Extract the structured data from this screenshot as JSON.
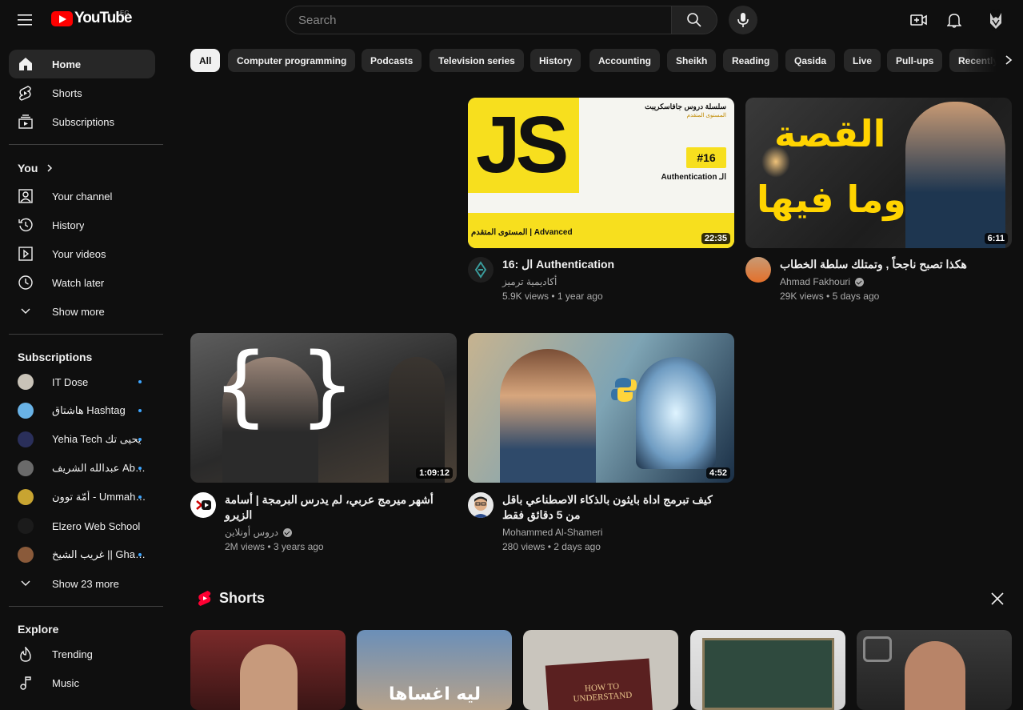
{
  "header": {
    "logo_text": "YouTube",
    "country_code": "EG",
    "search_placeholder": "Search"
  },
  "sidebar": {
    "main": [
      {
        "label": "Home",
        "icon": "home-icon"
      },
      {
        "label": "Shorts",
        "icon": "shorts-icon"
      },
      {
        "label": "Subscriptions",
        "icon": "subscriptions-icon"
      }
    ],
    "you_heading": "You",
    "you": [
      {
        "label": "Your channel",
        "icon": "your-channel-icon"
      },
      {
        "label": "History",
        "icon": "history-icon"
      },
      {
        "label": "Your videos",
        "icon": "your-videos-icon"
      },
      {
        "label": "Watch later",
        "icon": "watch-later-icon"
      },
      {
        "label": "Show more",
        "icon": "chevron-down-icon"
      }
    ],
    "subscriptions_heading": "Subscriptions",
    "subscriptions": [
      {
        "label": "IT Dose",
        "color": "#c9c3b8",
        "new": true
      },
      {
        "label": "هاشتاق Hashtag",
        "color": "#69b3e7",
        "new": true
      },
      {
        "label": "Yehia Tech يحيى تك",
        "color": "#2a2f5a",
        "new": true
      },
      {
        "label": "عبدالله الشريف Abdullah",
        "color": "#6a6a6a",
        "new": true
      },
      {
        "label": "أمّة توون - Ummah Toon",
        "color": "#c8a431",
        "new": true
      },
      {
        "label": "Elzero Web School",
        "color": "#1b1b1b",
        "new": false
      },
      {
        "label": "غريب الشيخ || Gharib",
        "color": "#8a5a3a",
        "new": true
      }
    ],
    "show_more_subs": "Show 23 more",
    "explore_heading": "Explore",
    "explore": [
      {
        "label": "Trending",
        "icon": "trending-icon"
      },
      {
        "label": "Music",
        "icon": "music-icon"
      }
    ]
  },
  "chips": [
    "All",
    "Computer programming",
    "Podcasts",
    "Television series",
    "History",
    "Accounting",
    "Sheikh",
    "Reading",
    "Qasida",
    "Live",
    "Pull-ups",
    "Recently uploaded"
  ],
  "videos": [
    {
      "title": "16: ال Authentication",
      "channel": "أكاديمية ترميز",
      "verified": false,
      "views": "5.9K views",
      "age": "1 year ago",
      "duration": "22:35",
      "thumb_text": {
        "js": "JS",
        "series": "سلسلة دروس جافاسكريبت",
        "level": "المستوى المتقدم",
        "episode": "#16",
        "topic": "Authentication الـ",
        "banner": "المستوى المتقدم | Advanced"
      }
    },
    {
      "title": "هكذا تصبح ناجحاً , وتمتلك سلطة الخطاب",
      "channel": "Ahmad Fakhouri",
      "verified": true,
      "views": "29K views",
      "age": "5 days ago",
      "duration": "6:11",
      "thumb_text": {
        "line1": "القصة",
        "line2": "وما فيها"
      }
    },
    {
      "title": "أشهر ميرمج عربي، لم يدرس البرمجة | أسامة الزيرو",
      "channel": "دروس أونلاين",
      "verified": true,
      "views": "2M views",
      "age": "3 years ago",
      "duration": "1:09:12"
    },
    {
      "title": "كيف تبرمج اداة بايثون بالذكاء الاصطناعي باقل من 5 دقائق فقط",
      "channel": "Mohammed Al-Shameri",
      "verified": false,
      "views": "280 views",
      "age": "2 days ago",
      "duration": "4:52"
    }
  ],
  "shorts": {
    "heading": "Shorts",
    "items": [
      {
        "bg": "#7a2a2a"
      },
      {
        "bg": "#5b7da8",
        "text": "ليه اغساها"
      },
      {
        "bg": "#b9b5ae",
        "text": "HOW TO UNDERSTAND"
      },
      {
        "bg": "#2e4a3e"
      },
      {
        "bg": "#3a3a3a"
      }
    ]
  }
}
